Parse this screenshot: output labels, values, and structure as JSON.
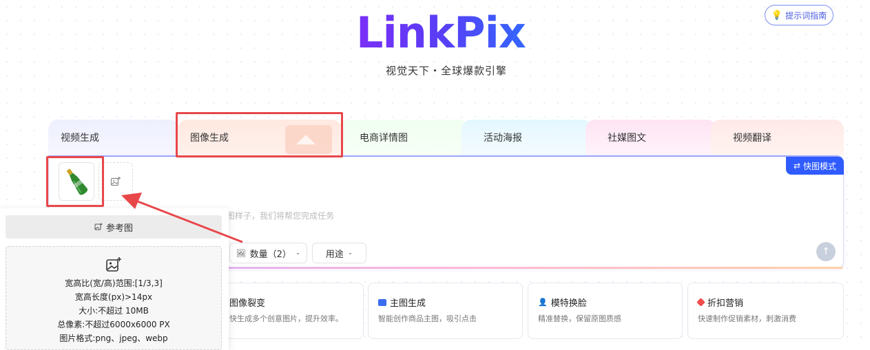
{
  "header": {
    "logo": "LinkPix",
    "slogan": "视觉天下・全球爆款引擎",
    "guide_button": "提示词指南"
  },
  "tabs": [
    {
      "label": "视频生成"
    },
    {
      "label": "图像生成"
    },
    {
      "label": "电商详情图"
    },
    {
      "label": "活动海报"
    },
    {
      "label": "社媒图文"
    },
    {
      "label": "视频翻译"
    }
  ],
  "panel": {
    "quick_mode_label": "快图模式",
    "placeholder": "图样子，我们将帮您完成任务",
    "count_label": "数量（2）",
    "use_label": "用途"
  },
  "cards": [
    {
      "title": "图像裂变",
      "desc": "快生成多个创意图片，提升效率。"
    },
    {
      "title": "主图生成",
      "desc": "智能创作商品主图，吸引点击"
    },
    {
      "title": "模特换脸",
      "desc": "精准替换，保留原图质感"
    },
    {
      "title": "折扣营销",
      "desc": "快速制作促销素材，刺激消费"
    }
  ],
  "popup": {
    "title": "参考图",
    "rules": [
      "宽高比(宽/高)范围:[1/3,3]",
      "宽高长度(px)>14px",
      "大小:不超过 10MB",
      "总像素:不超过6000x6000 PX",
      "图片格式:png、jpeg、webp"
    ]
  },
  "colors": {
    "accent": "#2f5bff",
    "highlight": "#e8474a"
  }
}
